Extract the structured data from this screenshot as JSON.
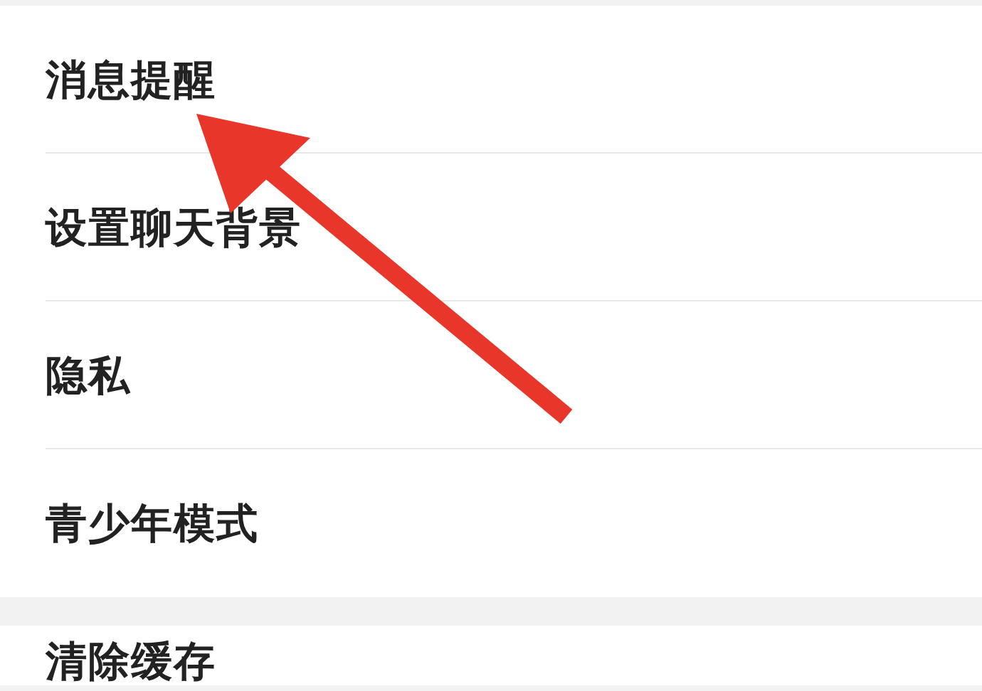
{
  "sections": [
    {
      "items": [
        {
          "label": "消息提醒"
        },
        {
          "label": "设置聊天背景"
        },
        {
          "label": "隐私"
        },
        {
          "label": "青少年模式"
        }
      ]
    },
    {
      "items": [
        {
          "label": "清除缓存"
        }
      ]
    }
  ]
}
